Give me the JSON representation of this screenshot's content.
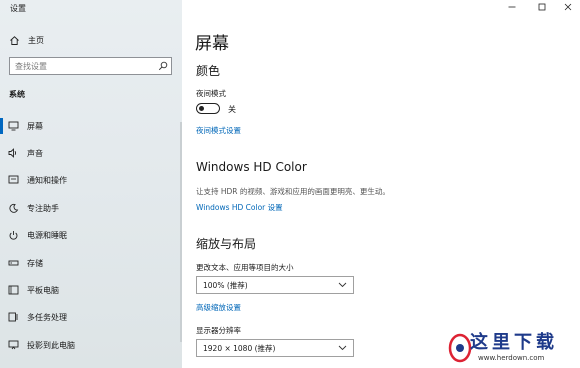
{
  "window": {
    "title": "设置"
  },
  "sidebar": {
    "home_label": "主页",
    "search_placeholder": "查找设置",
    "section_title": "系统",
    "items": [
      {
        "label": "屏幕",
        "icon": "monitor-icon"
      },
      {
        "label": "声音",
        "icon": "speaker-icon"
      },
      {
        "label": "通知和操作",
        "icon": "notification-icon"
      },
      {
        "label": "专注助手",
        "icon": "moon-icon"
      },
      {
        "label": "电源和睡眠",
        "icon": "power-icon"
      },
      {
        "label": "存储",
        "icon": "storage-icon"
      },
      {
        "label": "平板电脑",
        "icon": "tablet-icon"
      },
      {
        "label": "多任务处理",
        "icon": "multitask-icon"
      },
      {
        "label": "投影到此电脑",
        "icon": "projection-icon"
      }
    ],
    "active_index": 0
  },
  "main": {
    "page_title": "屏幕",
    "color": {
      "heading": "颜色",
      "night_mode_label": "夜间模式",
      "toggle_state": "关",
      "night_mode_settings_link": "夜间模式设置"
    },
    "hd_color": {
      "heading": "Windows HD Color",
      "description": "让支持 HDR 的视频、游戏和应用的画面更明亮、更生动。",
      "settings_link": "Windows HD Color 设置"
    },
    "scale": {
      "heading": "缩放与布局",
      "text_size_label": "更改文本、应用等项目的大小",
      "text_size_value": "100% (推荐)",
      "advanced_link": "高级缩放设置",
      "resolution_label": "显示器分辨率",
      "resolution_value": "1920 × 1080 (推荐)"
    }
  },
  "watermark": {
    "text": "这里下载",
    "url": "www.herdown.com"
  },
  "colors": {
    "accent": "#0067c0",
    "link": "#0067b8",
    "sidebar_bg": "#e6ecef"
  }
}
